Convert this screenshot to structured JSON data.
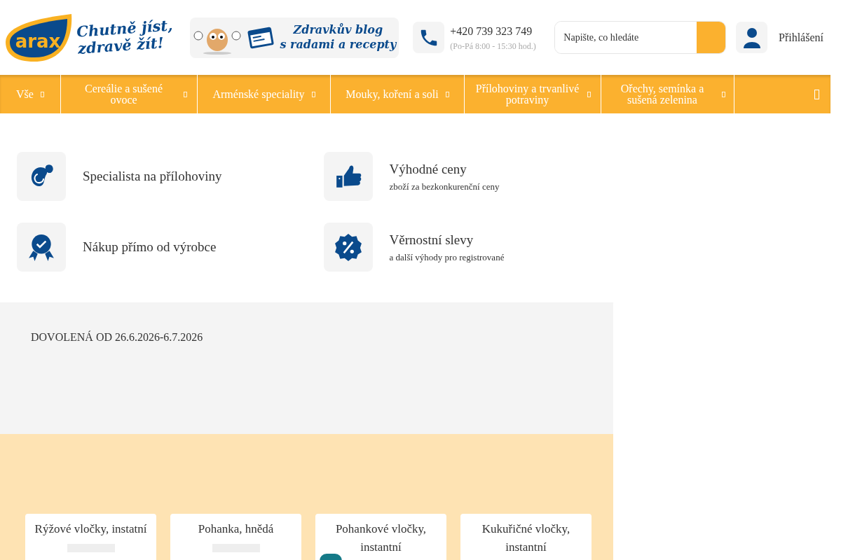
{
  "header": {
    "logo_text": "arax",
    "slogan_line1": "Chutně jíst,",
    "slogan_line2": "zdravě žít!",
    "blog_line1": "Zdravkův blog",
    "blog_line2": "s radami a recepty",
    "phone": "+420 739 323 749",
    "hours": "(Po-Pá 8:00 - 15:30 hod.)",
    "search": {
      "placeholder": "Napište, co hledáte"
    },
    "login": "Přihlášení"
  },
  "nav": [
    {
      "label": "Vše"
    },
    {
      "label": "Cereálie a sušené ovoce"
    },
    {
      "label": "Arménské speciality"
    },
    {
      "label": "Mouky, koření a soli"
    },
    {
      "label": "Přílohoviny a trvanlivé potraviny"
    },
    {
      "label": "Ořechy, semínka a sušená zelenina"
    }
  ],
  "features": [
    {
      "kind": "bean",
      "title": "Specialista na přílohoviny"
    },
    {
      "kind": "thumb",
      "title": "Výhodné ceny",
      "subtitle": "zboží za bezkonkurenční ceny"
    },
    {
      "kind": "award",
      "title": "Nákup přímo od výrobce"
    },
    {
      "kind": "percent",
      "title": "Věrnostní slevy",
      "subtitle": "a další výhody pro registrované"
    }
  ],
  "notice": "DOVOLENÁ OD 26.6.2026-6.7.2026",
  "products": [
    {
      "name": "Rýžové vločky, instatní",
      "badge": false
    },
    {
      "name": "Pohanka, hnědá",
      "badge": false
    },
    {
      "name": "Pohankové vločky, instantní",
      "badge": true
    },
    {
      "name": "Kukuřičné vločky, instantní",
      "badge": false
    }
  ]
}
